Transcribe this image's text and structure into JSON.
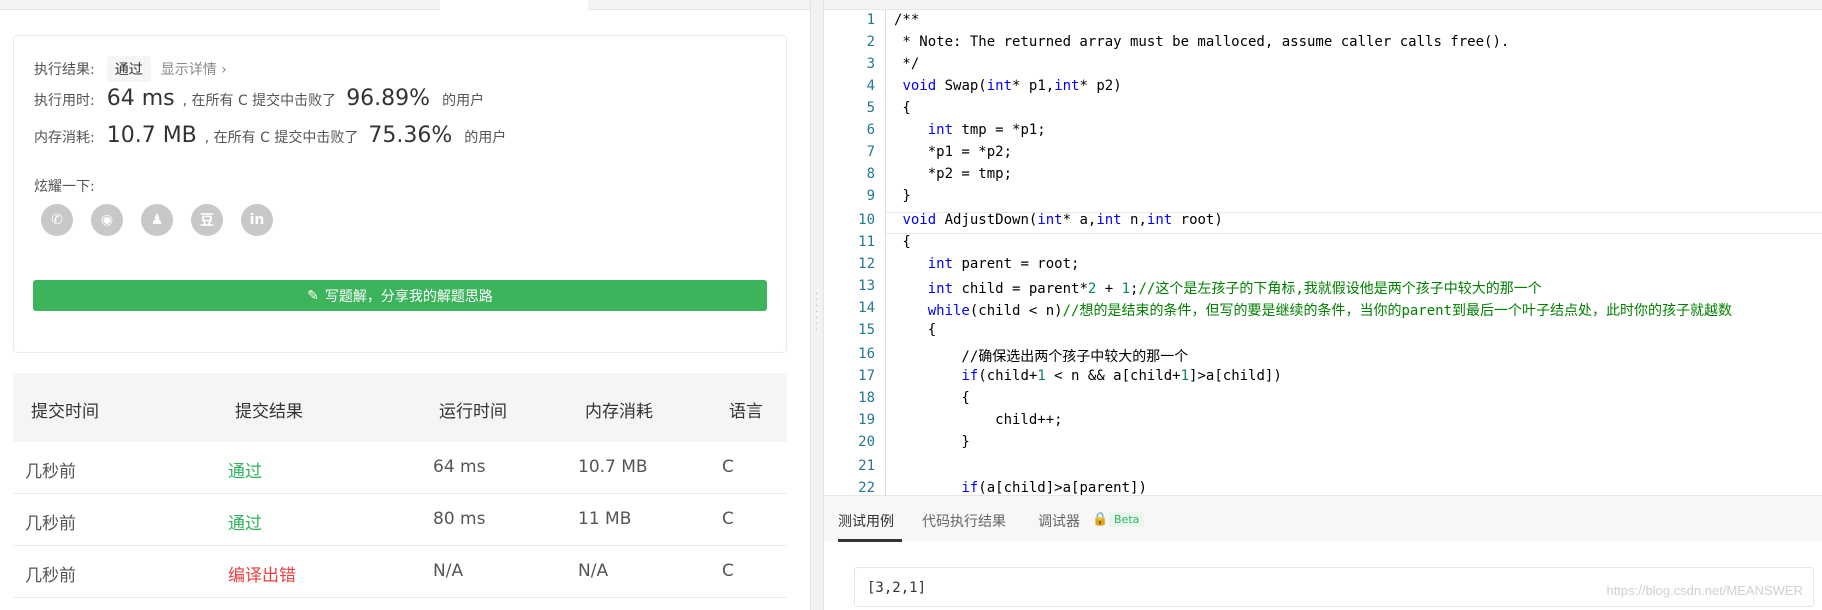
{
  "result": {
    "label_result": "执行结果:",
    "status": "通过",
    "detail_link": "显示详情 ›",
    "label_time": "执行用时:",
    "time_value": "64 ms",
    "beat_text_1": ", 在所有 C 提交中击败了",
    "time_pct": "96.89%",
    "users_text_1": "的用户",
    "label_mem": "内存消耗:",
    "mem_value": "10.7 MB",
    "beat_text_2": ", 在所有 C 提交中击败了",
    "mem_pct": "75.36%",
    "users_text_2": "的用户",
    "share_label": "炫耀一下:",
    "share_icons": [
      "wechat-icon",
      "weibo-icon",
      "qq-icon",
      "douban-icon",
      "linkedin-icon"
    ],
    "write_button": "写题解，分享我的解题思路"
  },
  "submissions": {
    "headers": [
      "提交时间",
      "提交结果",
      "运行时间",
      "内存消耗",
      "语言"
    ],
    "rows": [
      {
        "time": "几秒前",
        "result": "通过",
        "runtime": "64 ms",
        "memory": "10.7 MB",
        "lang": "C"
      },
      {
        "time": "几秒前",
        "result": "通过",
        "runtime": "80 ms",
        "memory": "11 MB",
        "lang": "C"
      },
      {
        "time": "几秒前",
        "result": "编译出错",
        "runtime": "N/A",
        "memory": "N/A",
        "lang": "C"
      }
    ]
  },
  "editor": {
    "line_numbers": [
      "1",
      "2",
      "3",
      "4",
      "5",
      "6",
      "7",
      "8",
      "9",
      "10",
      "11",
      "12",
      "13",
      "14",
      "15",
      "16",
      "17",
      "18",
      "19",
      "20",
      "21",
      "22"
    ],
    "lines": [
      "/**",
      " * Note: The returned array must be malloced, assume caller calls free().",
      " */",
      " void Swap(int* p1,int* p2)",
      " {",
      "    int tmp = *p1;",
      "    *p1 = *p2;",
      "    *p2 = tmp;",
      " }",
      " void AdjustDown(int* a,int n,int root)",
      " {",
      "    int parent = root;",
      "    int child = parent*2 + 1;//这个是左孩子的下角标,我就假设他是两个孩子中较大的那一个",
      "    while(child < n)//想的是结束的条件，但写的要是继续的条件，当你的parent到最后一个叶子结点处，此时你的孩子就越数",
      "    {",
      "        //确保选出两个孩子中较大的那一个",
      "        if(child+1 < n && a[child+1]>a[child])",
      "        {",
      "            child++;",
      "        }",
      "",
      "        if(a[child]>a[parent])"
    ]
  },
  "test_panel": {
    "tabs": [
      "测试用例",
      "代码执行结果",
      "调试器"
    ],
    "beta": "Beta",
    "input": "[3,2,1]"
  },
  "watermark": "https://blog.csdn.net/MEANSWER",
  "colors": {
    "accent_green": "#3bb45b",
    "error_red": "#e94040",
    "keyword_blue": "#0000ff",
    "comment_green": "#008000"
  }
}
